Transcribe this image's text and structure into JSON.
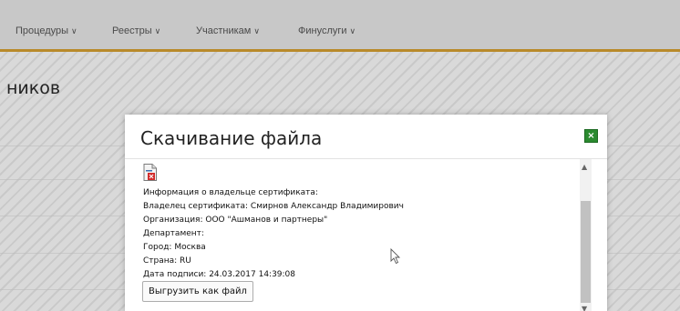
{
  "nav": {
    "items": [
      "Процедуры",
      "Реестры",
      "Участникам",
      "Финуслуги"
    ],
    "chevron": "∨"
  },
  "page": {
    "title_fragment": "ников"
  },
  "modal": {
    "title": "Скачивание файла",
    "close_label": "×",
    "info_lines": [
      "Информация о владельце сертификата:",
      "Владелец сертификата: Смирнов Александр Владимирович",
      "Организация: ООО \"Ашманов и партнеры\"",
      "Департамент:",
      "Город: Москва",
      "Страна: RU",
      "Дата подписи: 24.03.2017 14:39:08"
    ],
    "export_button": "Выгрузить как файл"
  },
  "colors": {
    "nav_border": "#b98a2a",
    "close_button": "#2a8a2f"
  }
}
